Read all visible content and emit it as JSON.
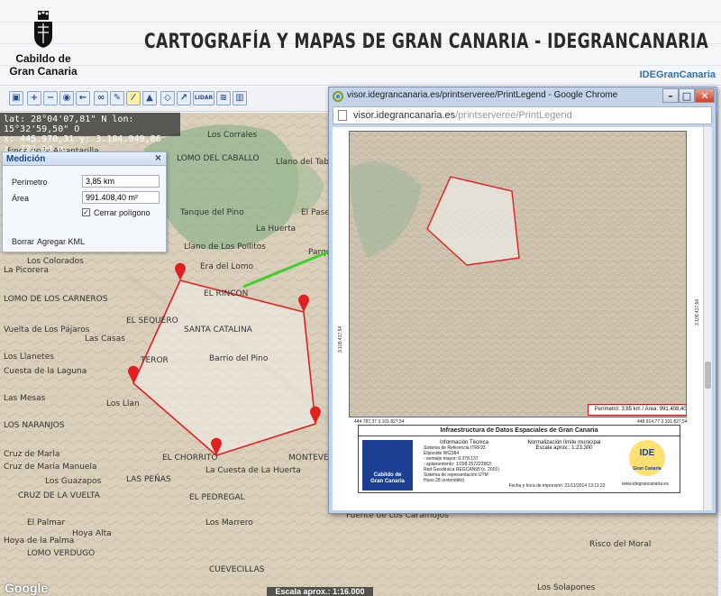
{
  "header": {
    "logo_line1": "Cabildo de",
    "logo_line2": "Gran Canaria",
    "title": "CARTOGRAFÍA Y MAPAS DE GRAN CANARIA - IDEGRANCANARIA",
    "brand": "IDEGranCanaria"
  },
  "toolbar": {
    "tools": [
      "layers-icon",
      "zoom-in-icon",
      "zoom-out-icon",
      "zoom-extent-icon",
      "back-icon",
      "link-icon",
      "pencil-icon",
      "measure-icon",
      "profile-icon",
      "polygon-icon",
      "route-icon",
      "lidar-icon",
      "stack-icon",
      "split-icon"
    ],
    "lidar_label": "LIDAR"
  },
  "coords": {
    "line1": "lat: 28°04'07,81\" N  lon: 15°32'59,50\" O",
    "line2": "x: 445.970,31  y: 3.104.949,86  z: 722,90 m."
  },
  "measure_panel": {
    "title": "Medición",
    "perimeter_label": "Perímetro",
    "perimeter_value": "3,85 km",
    "area_label": "Área",
    "area_value": "991.408,40 m²",
    "close_polygon_label": "Cerrar polígono",
    "close_polygon_checked": true,
    "clear_label": "Borrar",
    "add_kml_label": "Agregar KML"
  },
  "map_labels": [
    "Finca de la Alcantarilla",
    "LOMO DEL CABALLO",
    "Llano del Tabuco",
    "Los Corrales",
    "Tanque del Pino",
    "El Paselo",
    "La Huerta",
    "Llano de Los Pollitos",
    "Era del Lomo",
    "Parque los",
    "Los Colorados",
    "La Picorera",
    "LOMO DE LOS CARNEROS",
    "EL RINCON",
    "EL SEQUERO",
    "SANTA CATALINA",
    "Vuelta de Los Pájaros",
    "Las Casas",
    "Los Llanetes",
    "TEROR",
    "Barrio del Pino",
    "Cuesta de la Laguna",
    "Las Mesas",
    "Los Llan",
    "LOS NARANJOS",
    "EL CHORRITO",
    "Cruz de Marla",
    "La Cuesta de La Huerta",
    "Los Guazapos",
    "LAS PEÑAS",
    "Cruz de María Manuela",
    "CRUZ DE LA VUELTA",
    "EL PEDREGAL",
    "Los Marrero",
    "El Palmar",
    "Hoya Alta",
    "Hoya de la Palma",
    "LOMO VERDUGO",
    "CUEVECILLAS",
    "Los Solapones",
    "Risco del Moral",
    "MONTEVERDE",
    "Fuente de Los Caramujos"
  ],
  "map": {
    "google_label": "Google",
    "scale_label": "Escala aprox.: 1:16.000",
    "polygon_color": "#e02020",
    "arrow_color": "#3ecf2a"
  },
  "chrome": {
    "title": "visor.idegrancanaria.es/printserveree/PrintLegend - Google Chrome",
    "url_host": "visor.idegrancanaria.es",
    "url_path": "/printserveree/PrintLegend",
    "min_label": "–",
    "max_label": "□",
    "close_label": "✕"
  },
  "print": {
    "legend": "Perímetro: 3,85 km / Área: 991.408,40 m²",
    "coord_bl": "444.787,37  3.101.827,54",
    "coord_br": "448.914,77  3.101.827,54",
    "coord_left": "3.105.417,54",
    "coord_right": "3.105.417,54",
    "cart_title": "Infraestructura de Datos Espaciales de Gran Canaria",
    "cart_logo_l1": "Cabildo de",
    "cart_logo_l2": "Gran Canaria",
    "info_head": "Información Técnica",
    "info_lines": [
      "Sistema de Referencia ITRF93",
      "Elipsoide WGS84",
      "- semieje mayor: 6.378.137",
      "- aplanamiento: 1/298,257223563",
      "Red Geodésica REGCAN95 (c. 2001)",
      "Sistema de representación UTM",
      "Huso 28 (extendido)"
    ],
    "norm_head": "Normalización límite municipal",
    "scale_text": "Escala aprox.: 1:23.300",
    "date_text": "Fecha y hora de impresión: 21/11/2014 13:11:22",
    "ide_label": "IDE",
    "ide_sub": "Gran Canaria",
    "ide_url": "www.idegrancanaria.es"
  }
}
